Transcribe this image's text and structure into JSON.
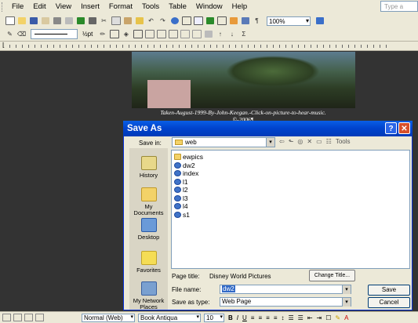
{
  "menubar": {
    "items": [
      "File",
      "Edit",
      "View",
      "Insert",
      "Format",
      "Tools",
      "Table",
      "Window",
      "Help"
    ],
    "help_placeholder": "Type a"
  },
  "toolbar": {
    "zoom": "100%",
    "line_weight": "½pt"
  },
  "document": {
    "caption_line1": "Taken-August-1999-By-John-Keegan.-Click-on-picture-to-hear-music.",
    "caption_line2": "©-2006¶"
  },
  "dialog": {
    "title": "Save As",
    "save_in_label": "Save in:",
    "save_in_value": "web",
    "tools_label": "Tools",
    "places": [
      "History",
      "My Documents",
      "Desktop",
      "Favorites",
      "My Network Places"
    ],
    "files": [
      {
        "name": "ewpics",
        "kind": "folder"
      },
      {
        "name": "dw2",
        "kind": "ie"
      },
      {
        "name": "index",
        "kind": "ie"
      },
      {
        "name": "l1",
        "kind": "ie"
      },
      {
        "name": "l2",
        "kind": "ie"
      },
      {
        "name": "l3",
        "kind": "ie"
      },
      {
        "name": "l4",
        "kind": "ie"
      },
      {
        "name": "s1",
        "kind": "ie"
      }
    ],
    "page_title_label": "Page title:",
    "page_title_value": "Disney World Pictures",
    "change_title_button": "Change Title...",
    "file_name_label": "File name:",
    "file_name_value": "dw2",
    "save_as_type_label": "Save as type:",
    "save_as_type_value": "Web Page",
    "save_button": "Save",
    "cancel_button": "Cancel"
  },
  "formatting": {
    "style": "Normal (Web)",
    "font": "Book Antiqua",
    "size": "10"
  }
}
